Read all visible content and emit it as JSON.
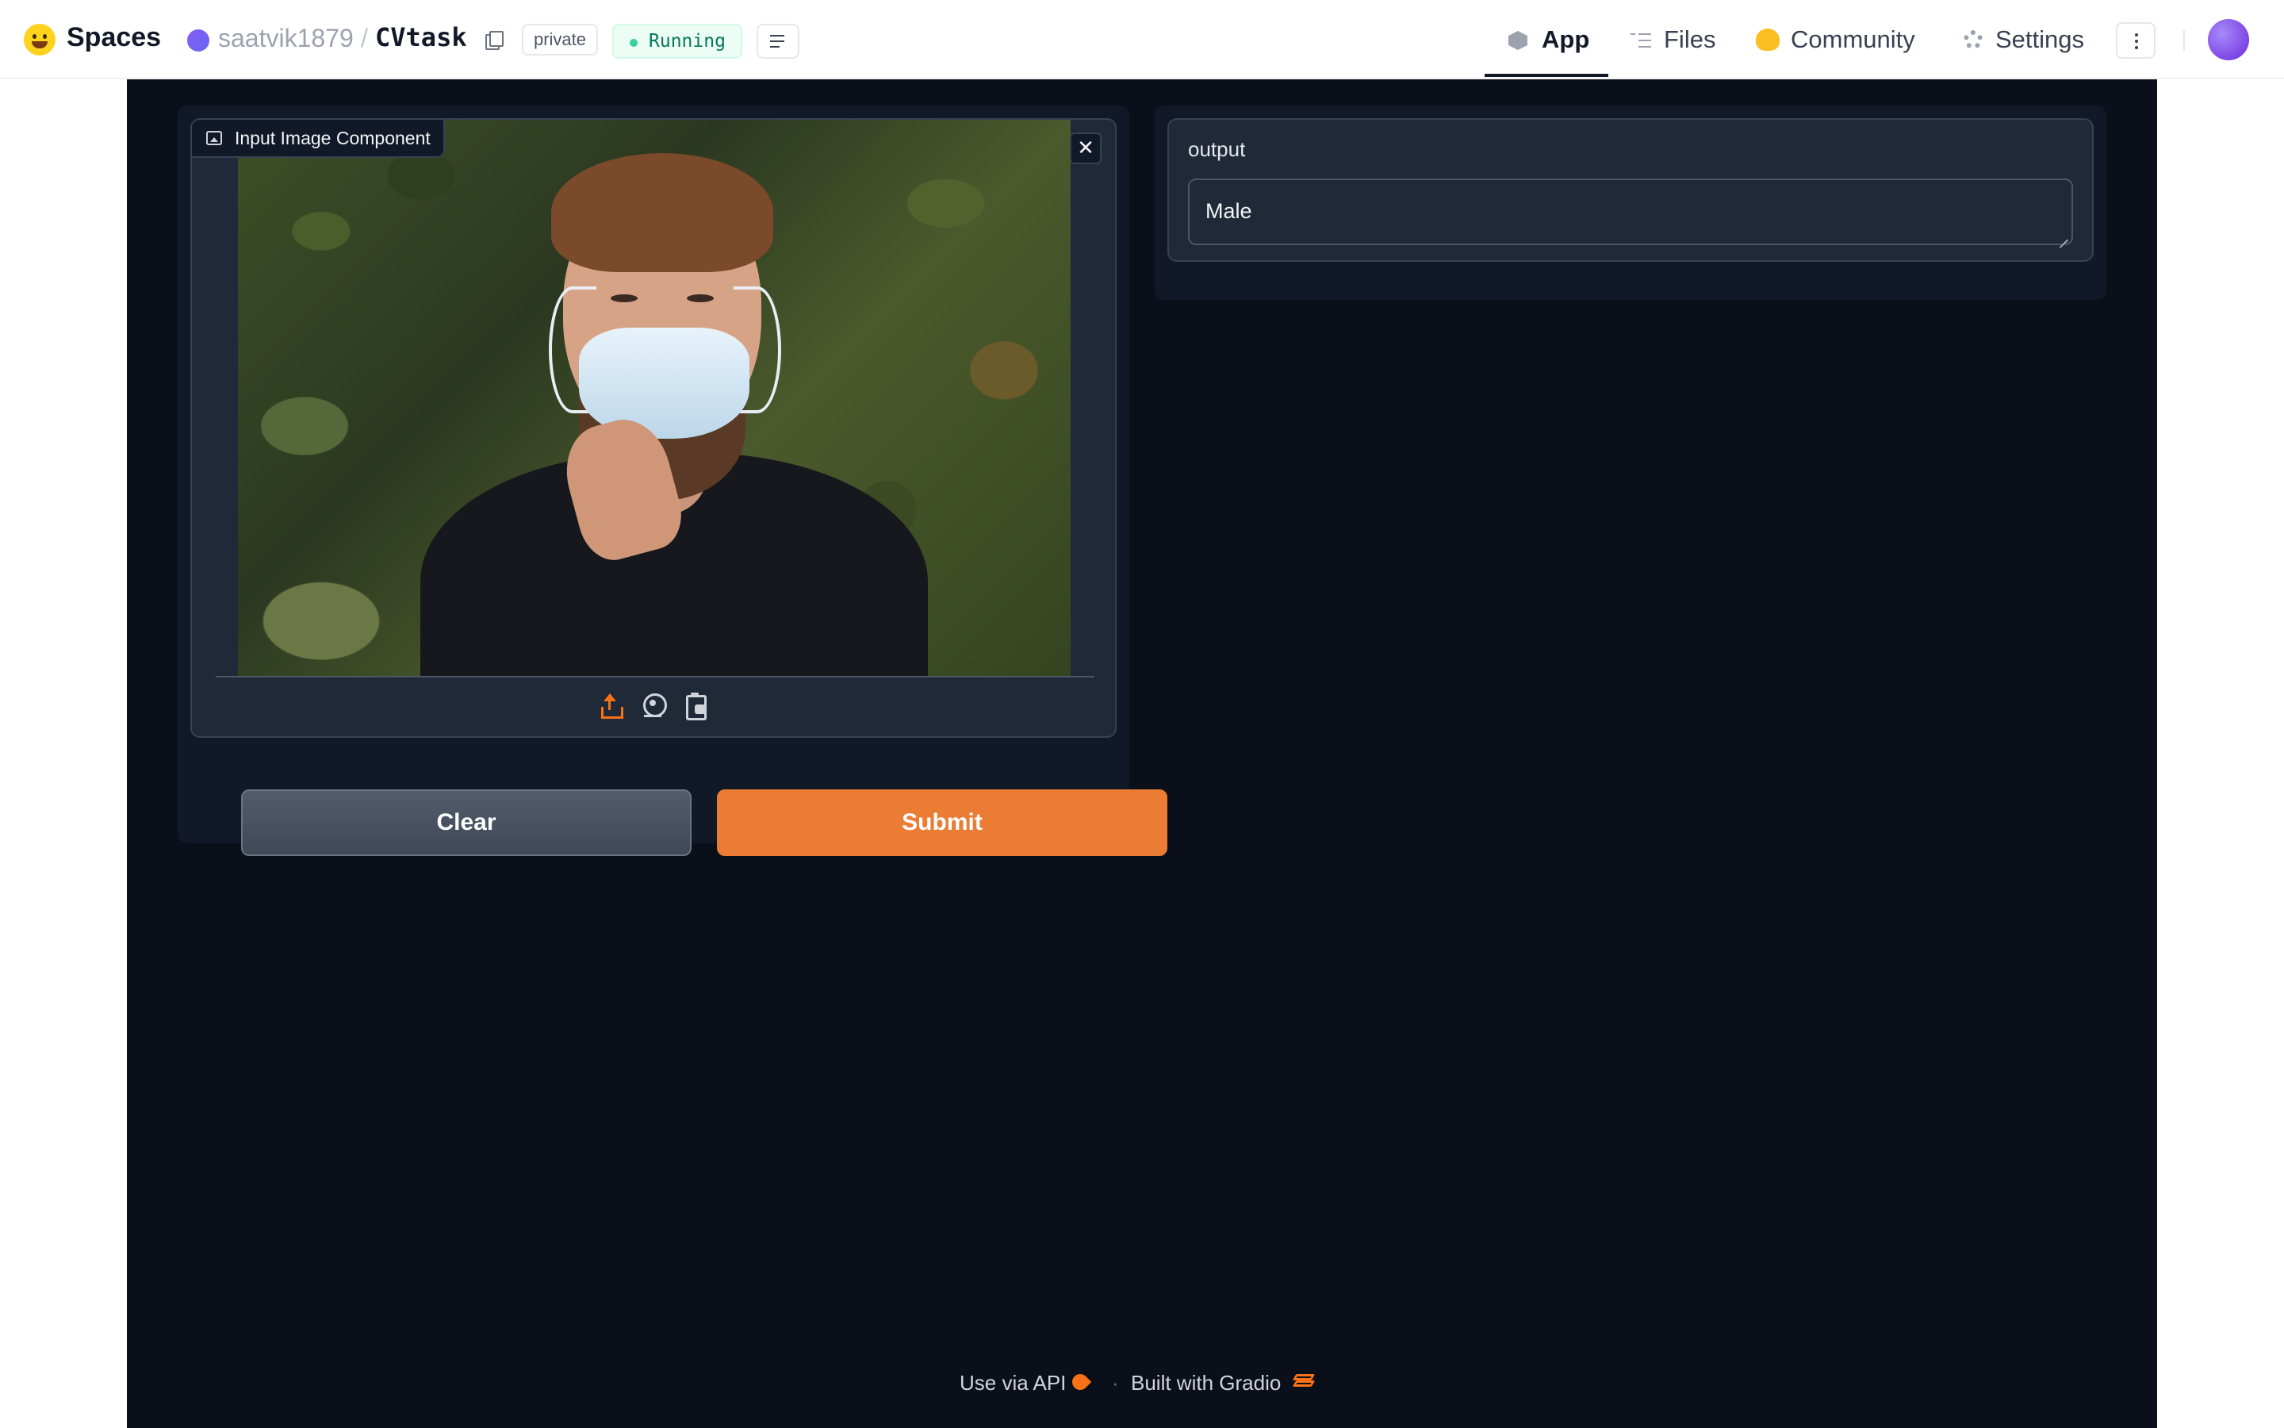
{
  "header": {
    "brand": "Spaces",
    "owner": "saatvik1879",
    "separator": "/",
    "repo": "CVtask",
    "visibility_badge": "private",
    "status_badge": "Running",
    "status_color": "#34d399",
    "nav": [
      {
        "label": "App",
        "icon": "cube-icon",
        "active": true
      },
      {
        "label": "Files",
        "icon": "files-icon",
        "active": false
      },
      {
        "label": "Community",
        "icon": "community-icon",
        "active": false
      },
      {
        "label": "Settings",
        "icon": "gear-icon",
        "active": false
      }
    ]
  },
  "app": {
    "input": {
      "label": "Input Image Component",
      "image_description": "Man with beard wearing face mask",
      "tools": [
        "upload-icon",
        "webcam-icon",
        "clipboard-icon"
      ]
    },
    "buttons": {
      "clear_label": "Clear",
      "submit_label": "Submit",
      "submit_color": "#ea7c34"
    },
    "output": {
      "label": "output",
      "value": "Male"
    }
  },
  "footer": {
    "api_label": "Use via API",
    "separator": "·",
    "built_with": "Built with Gradio"
  }
}
